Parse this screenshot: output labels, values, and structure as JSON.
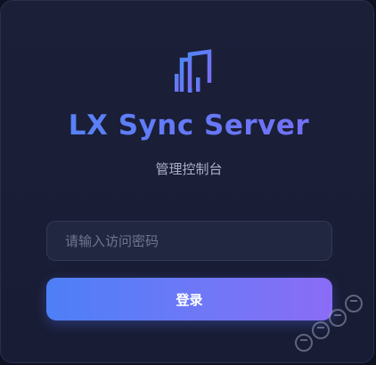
{
  "app": {
    "title": "LX Sync Server",
    "subtitle": "管理控制台"
  },
  "login": {
    "password_placeholder": "请输入访问密码",
    "password_value": "",
    "submit_label": "登录"
  },
  "colors": {
    "accent_start": "#4d7ff7",
    "accent_end": "#8a6cf6",
    "background": "#181c34"
  },
  "icons": {
    "logo": "lx-sync-logo-icon"
  }
}
